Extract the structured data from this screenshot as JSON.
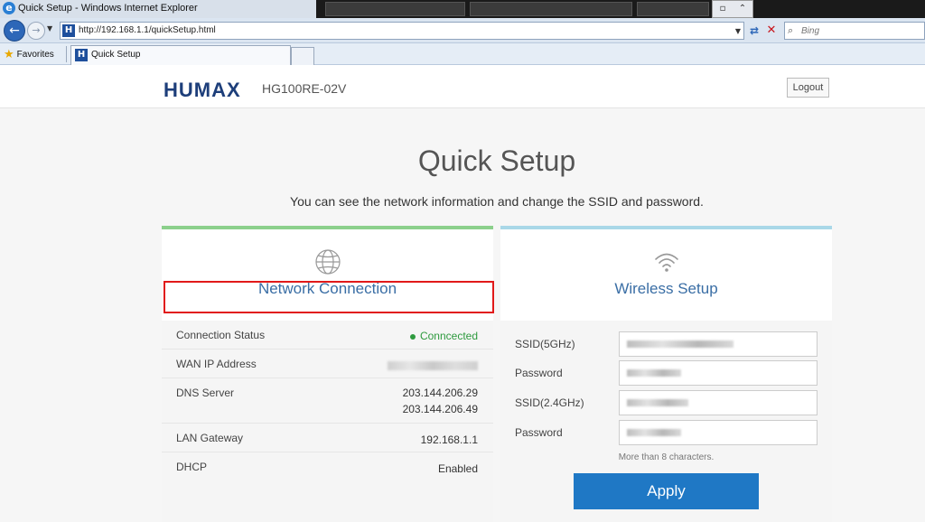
{
  "browser": {
    "window_title": "Quick Setup - Windows Internet Explorer",
    "url": "http://192.168.1.1/quickSetup.html",
    "search_placeholder": "Bing",
    "favorites_label": "Favorites",
    "tab_label": "Quick Setup"
  },
  "header": {
    "logo": "HUMAX",
    "model": "HG100RE-02V",
    "logout_label": "Logout"
  },
  "main": {
    "title": "Quick Setup",
    "subtitle": "You can see the network information and change the SSID and password."
  },
  "network": {
    "title": "Network Connection",
    "rows": [
      {
        "label": "Connection Status",
        "value": "Conncected"
      },
      {
        "label": "WAN IP Address",
        "value": ""
      },
      {
        "label": "DNS Server",
        "value": "203.144.206.29",
        "value2": "203.144.206.49"
      },
      {
        "label": "LAN Gateway",
        "value": "192.168.1.1"
      },
      {
        "label": "DHCP",
        "value": "Enabled"
      }
    ]
  },
  "wireless": {
    "title": "Wireless Setup",
    "fields": [
      {
        "label": "SSID(5GHz)"
      },
      {
        "label": "Password"
      },
      {
        "label": "SSID(2.4GHz)"
      },
      {
        "label": "Password"
      }
    ],
    "hint": "More than 8 characters.",
    "apply_label": "Apply"
  },
  "colors": {
    "brand": "#1d3e7a",
    "network_accent": "#8cd08c",
    "wireless_accent": "#a9d8e8",
    "apply": "#1f78c5",
    "status_ok": "#2e9a3e",
    "highlight": "#e11919"
  }
}
